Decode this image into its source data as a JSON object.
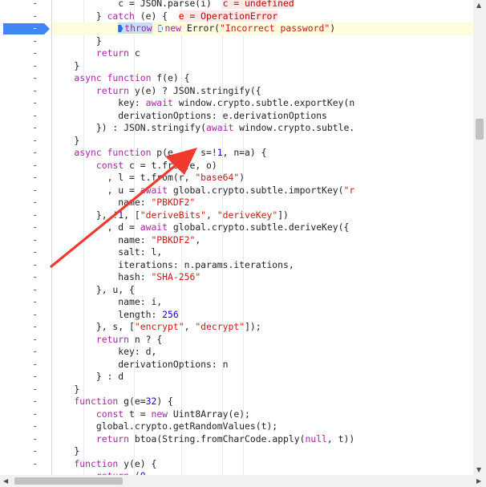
{
  "gutter_marker": "-",
  "breakpoint_marker": "-",
  "arrows": {
    "up": "▲",
    "down": "▼",
    "left": "◀",
    "right": "▶"
  },
  "colors": {
    "breakpoint": "#4285f4",
    "paused_line": "#fffbdd",
    "annotation_arrow": "#f03a2e"
  },
  "code_lines": [
    [
      [
        "plain",
        "            c = JSON.parse(i)  "
      ],
      [
        "ival",
        "c = undefined"
      ]
    ],
    [
      [
        "plain",
        "        } "
      ],
      [
        "kw",
        "catch"
      ],
      [
        "plain",
        " (e) {  "
      ],
      [
        "ival",
        "e = OperationError"
      ]
    ],
    [
      [
        "plain",
        "            "
      ],
      [
        "throw",
        "throw"
      ],
      [
        "plain",
        " "
      ],
      [
        "new",
        "new"
      ],
      [
        "plain",
        " Error("
      ],
      [
        "str",
        "\"Incorrect password\""
      ],
      [
        "plain",
        ")"
      ]
    ],
    [
      [
        "plain",
        "        }"
      ]
    ],
    [
      [
        "plain",
        "        "
      ],
      [
        "kw",
        "return"
      ],
      [
        "plain",
        " c"
      ]
    ],
    [
      [
        "plain",
        "    }"
      ]
    ],
    [
      [
        "kw",
        "    async function"
      ],
      [
        "plain",
        " f(e) {"
      ]
    ],
    [
      [
        "plain",
        "        "
      ],
      [
        "kw",
        "return"
      ],
      [
        "plain",
        " y(e) ? JSON.stringify({"
      ]
    ],
    [
      [
        "plain",
        "            key: "
      ],
      [
        "kw",
        "await"
      ],
      [
        "plain",
        " window.crypto.subtle.exportKey(n"
      ]
    ],
    [
      [
        "plain",
        "            derivationOptions: e.derivationOptions"
      ]
    ],
    [
      [
        "plain",
        "        }) : JSON.stringify("
      ],
      [
        "kw",
        "await"
      ],
      [
        "plain",
        " window.crypto.subtle."
      ]
    ],
    [
      [
        "plain",
        "    }"
      ]
    ],
    [
      [
        "kw",
        "    async function"
      ],
      [
        "plain",
        " p(e, r, s=!"
      ],
      [
        "num",
        "1"
      ],
      [
        "plain",
        ", n=a) {"
      ]
    ],
    [
      [
        "plain",
        "        "
      ],
      [
        "kw",
        "const"
      ],
      [
        "plain",
        " c = t.from(e, o)"
      ]
    ],
    [
      [
        "plain",
        "          , l = t.from(r, "
      ],
      [
        "str",
        "\"base64\""
      ],
      [
        "plain",
        ")"
      ]
    ],
    [
      [
        "plain",
        "          , u = "
      ],
      [
        "kw",
        "await"
      ],
      [
        "plain",
        " global.crypto.subtle.importKey("
      ],
      [
        "str",
        "\"r"
      ]
    ],
    [
      [
        "plain",
        "            name: "
      ],
      [
        "str",
        "\"PBKDF2\""
      ]
    ],
    [
      [
        "plain",
        "        }, !"
      ],
      [
        "num",
        "1"
      ],
      [
        "plain",
        ", ["
      ],
      [
        "str",
        "\"deriveBits\""
      ],
      [
        "plain",
        ", "
      ],
      [
        "str",
        "\"deriveKey\""
      ],
      [
        "plain",
        "])"
      ]
    ],
    [
      [
        "plain",
        "          , d = "
      ],
      [
        "kw",
        "await"
      ],
      [
        "plain",
        " global.crypto.subtle.deriveKey({"
      ]
    ],
    [
      [
        "plain",
        "            name: "
      ],
      [
        "str",
        "\"PBKDF2\""
      ],
      [
        "plain",
        ","
      ]
    ],
    [
      [
        "plain",
        "            salt: l,"
      ]
    ],
    [
      [
        "plain",
        "            iterations: n.params.iterations,"
      ]
    ],
    [
      [
        "plain",
        "            hash: "
      ],
      [
        "str",
        "\"SHA-256\""
      ]
    ],
    [
      [
        "plain",
        "        }, u, {"
      ]
    ],
    [
      [
        "plain",
        "            name: i,"
      ]
    ],
    [
      [
        "plain",
        "            length: "
      ],
      [
        "num",
        "256"
      ]
    ],
    [
      [
        "plain",
        "        }, s, ["
      ],
      [
        "str",
        "\"encrypt\""
      ],
      [
        "plain",
        ", "
      ],
      [
        "str",
        "\"decrypt\""
      ],
      [
        "plain",
        "]);"
      ]
    ],
    [
      [
        "plain",
        "        "
      ],
      [
        "kw",
        "return"
      ],
      [
        "plain",
        " n ? {"
      ]
    ],
    [
      [
        "plain",
        "            key: d,"
      ]
    ],
    [
      [
        "plain",
        "            derivationOptions: n"
      ]
    ],
    [
      [
        "plain",
        "        } : d"
      ]
    ],
    [
      [
        "plain",
        "    }"
      ]
    ],
    [
      [
        "kw",
        "    function"
      ],
      [
        "plain",
        " g(e="
      ],
      [
        "num",
        "32"
      ],
      [
        "plain",
        ") {"
      ]
    ],
    [
      [
        "plain",
        "        "
      ],
      [
        "kw",
        "const"
      ],
      [
        "plain",
        " t = "
      ],
      [
        "kw",
        "new"
      ],
      [
        "plain",
        " Uint8Array(e);"
      ]
    ],
    [
      [
        "plain",
        "        global.crypto.getRandomValues(t);"
      ]
    ],
    [
      [
        "plain",
        "        "
      ],
      [
        "kw",
        "return"
      ],
      [
        "plain",
        " btoa(String.fromCharCode.apply("
      ],
      [
        "kw",
        "null"
      ],
      [
        "plain",
        ", t))"
      ]
    ],
    [
      [
        "plain",
        "    }"
      ]
    ],
    [
      [
        "kw",
        "    function"
      ],
      [
        "plain",
        " y(e) {"
      ]
    ],
    [
      [
        "plain",
        "        "
      ],
      [
        "kw",
        "return"
      ],
      [
        "plain",
        " ("
      ],
      [
        "num",
        "0"
      ],
      [
        "plain",
        ","
      ]
    ]
  ],
  "breakpoint_line_index": 2,
  "paused_line_index": 2
}
